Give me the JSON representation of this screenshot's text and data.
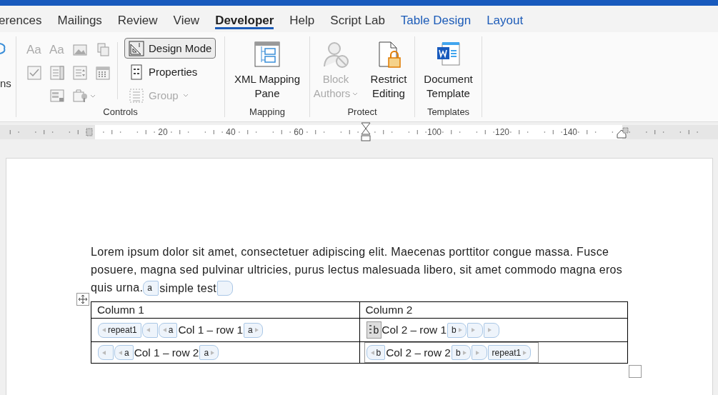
{
  "tabs": [
    {
      "label": "erences",
      "selected": false,
      "contextual": false
    },
    {
      "label": "Mailings",
      "selected": false,
      "contextual": false
    },
    {
      "label": "Review",
      "selected": false,
      "contextual": false
    },
    {
      "label": "View",
      "selected": false,
      "contextual": false
    },
    {
      "label": "Developer",
      "selected": true,
      "contextual": false
    },
    {
      "label": "Help",
      "selected": false,
      "contextual": false
    },
    {
      "label": "Script Lab",
      "selected": false,
      "contextual": false
    },
    {
      "label": "Table Design",
      "selected": false,
      "contextual": true
    },
    {
      "label": "Layout",
      "selected": false,
      "contextual": true
    }
  ],
  "ribbon": {
    "partial_button": {
      "label": "ns"
    },
    "controls": {
      "label": "Controls",
      "gallery_glyphs": [
        "Aa",
        "Aa"
      ],
      "buttons": [
        {
          "label": "Design Mode",
          "selected": true,
          "disabled": false,
          "dropdown": false
        },
        {
          "label": "Properties",
          "selected": false,
          "disabled": false,
          "dropdown": false
        },
        {
          "label": "Group",
          "selected": false,
          "disabled": true,
          "dropdown": true
        }
      ]
    },
    "mapping": {
      "label": "Mapping",
      "buttons": [
        {
          "label": "XML Mapping Pane",
          "disabled": false
        }
      ]
    },
    "protect": {
      "label": "Protect",
      "buttons": [
        {
          "label": "Block Authors",
          "disabled": true,
          "dropdown": true
        },
        {
          "label": "Restrict Editing",
          "disabled": false,
          "dropdown": false
        }
      ]
    },
    "templates": {
      "label": "Templates",
      "buttons": [
        {
          "label": "Document Template",
          "disabled": false
        }
      ]
    }
  },
  "ruler": {
    "labels": [
      "20",
      "40",
      "60",
      "100",
      "120",
      "140"
    ]
  },
  "document": {
    "paragraph_lines": [
      "Lorem ipsum dolor sit amet, consectetuer adipiscing elit. Maecenas porttitor congue massa. Fusce",
      "posuere, magna sed pulvinar ultricies, purus lectus malesuada libero, sit amet commodo magna eros",
      "quis urna."
    ],
    "inline_controls": [
      {
        "kind": "open",
        "label": "a"
      },
      {
        "kind": "text",
        "text": "simple test"
      },
      {
        "kind": "close"
      }
    ],
    "table": {
      "columns": [
        "Column 1",
        "Column 2"
      ],
      "rows": [
        {
          "selected": false,
          "cells": [
            [
              {
                "kind": "open",
                "label": "repeat1"
              },
              {
                "kind": "open"
              },
              {
                "kind": "open",
                "label": "a"
              },
              {
                "kind": "text",
                "text": "Col 1 – row 1"
              },
              {
                "kind": "close",
                "label": "a"
              }
            ],
            [
              {
                "kind": "handle",
                "label": "b"
              },
              {
                "kind": "text",
                "text": "Col 2 – row 1"
              },
              {
                "kind": "close",
                "label": "b"
              },
              {
                "kind": "close"
              },
              {
                "kind": "close"
              }
            ]
          ]
        },
        {
          "selected": true,
          "cells": [
            [
              {
                "kind": "open"
              },
              {
                "kind": "open",
                "label": "a"
              },
              {
                "kind": "text",
                "text": "Col 1 – row 2"
              },
              {
                "kind": "close",
                "label": "a"
              }
            ],
            [
              {
                "kind": "open",
                "label": "b"
              },
              {
                "kind": "text",
                "text": "Col 2 – row 2"
              },
              {
                "kind": "close",
                "label": "b"
              },
              {
                "kind": "close"
              },
              {
                "kind": "close",
                "label": "repeat1"
              }
            ]
          ]
        }
      ]
    }
  }
}
